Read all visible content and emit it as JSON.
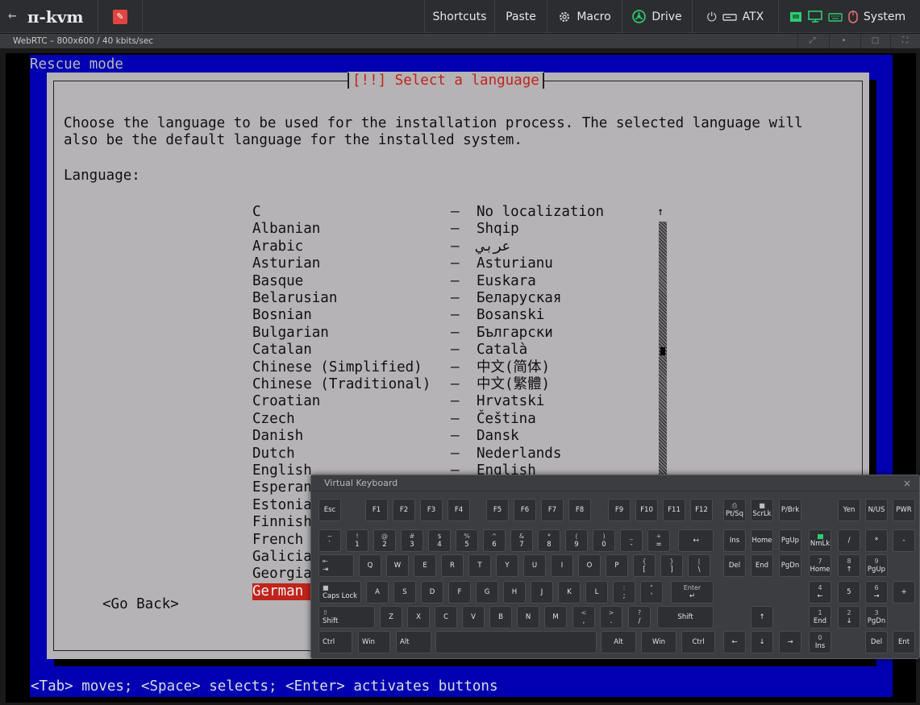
{
  "topbar": {
    "logo": "π-kvm",
    "back_arrow": "←",
    "items": [
      "Shortcuts",
      "Paste",
      "Macro",
      "Drive",
      "ATX",
      "System"
    ]
  },
  "stream": {
    "info": "WebRTC – 800x600 / 40 kbits/sec"
  },
  "installer": {
    "mode_label": "Rescue mode",
    "dialog_title": "[!!] Select a language",
    "description_line1": "Choose the language to be used for the installation process. The selected language will",
    "description_line2": "also be the default language for the installed system.",
    "language_label": "Language:",
    "languages": [
      {
        "name": "C",
        "native": "No localization"
      },
      {
        "name": "Albanian",
        "native": "Shqip"
      },
      {
        "name": "Arabic",
        "native": "عربي"
      },
      {
        "name": "Asturian",
        "native": "Asturianu"
      },
      {
        "name": "Basque",
        "native": "Euskara"
      },
      {
        "name": "Belarusian",
        "native": "Беларуская"
      },
      {
        "name": "Bosnian",
        "native": "Bosanski"
      },
      {
        "name": "Bulgarian",
        "native": "Български"
      },
      {
        "name": "Catalan",
        "native": "Català"
      },
      {
        "name": "Chinese (Simplified)",
        "native": "中文(简体)"
      },
      {
        "name": "Chinese (Traditional)",
        "native": "中文(繁體)"
      },
      {
        "name": "Croatian",
        "native": "Hrvatski"
      },
      {
        "name": "Czech",
        "native": "Čeština"
      },
      {
        "name": "Danish",
        "native": "Dansk"
      },
      {
        "name": "Dutch",
        "native": "Nederlands"
      },
      {
        "name": "English",
        "native": "English"
      },
      {
        "name": "Esperanto",
        "native": ""
      },
      {
        "name": "Estonian",
        "native": ""
      },
      {
        "name": "Finnish",
        "native": ""
      },
      {
        "name": "French",
        "native": ""
      },
      {
        "name": "Galician",
        "native": ""
      },
      {
        "name": "Georgian",
        "native": ""
      },
      {
        "name": "German",
        "native": ""
      }
    ],
    "selected_index": 22,
    "dash": "–",
    "scroll_up": "↑",
    "go_back": "<Go Back>",
    "status_line": "<Tab> moves; <Space> selects; <Enter> activates buttons"
  },
  "keyboard": {
    "title": "Virtual Keyboard",
    "close": "×"
  },
  "colors": {
    "installer_blue": "#0000b2",
    "dialog_gray": "#b5b3b5",
    "highlight_red": "#c0241c",
    "drive_green": "#2ecc71"
  }
}
